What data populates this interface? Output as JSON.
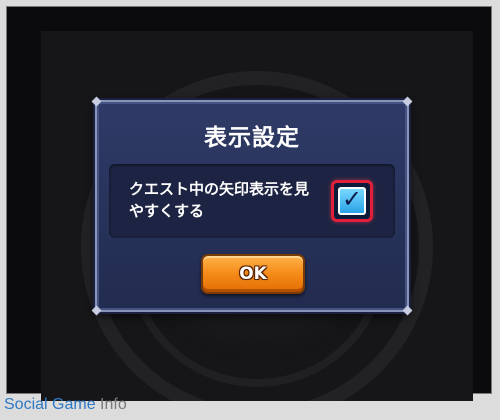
{
  "dialog": {
    "title": "表示設定",
    "option": {
      "label": "クエスト中の矢印表示を見やすくする",
      "checked": true,
      "check_glyph": "✓"
    },
    "ok_button_label": "OK"
  },
  "watermark": {
    "brand": "Social Game ",
    "suffix": "Info"
  },
  "colors": {
    "dialog_bg": "#2f3b66",
    "ok_button": "#f58a17",
    "checkbox_fill": "#2aa3e6",
    "checkbox_highlight": "#e0203a",
    "watermark_blue": "#2f78c4"
  },
  "icons": {
    "checkbox": "checkmark-icon"
  }
}
